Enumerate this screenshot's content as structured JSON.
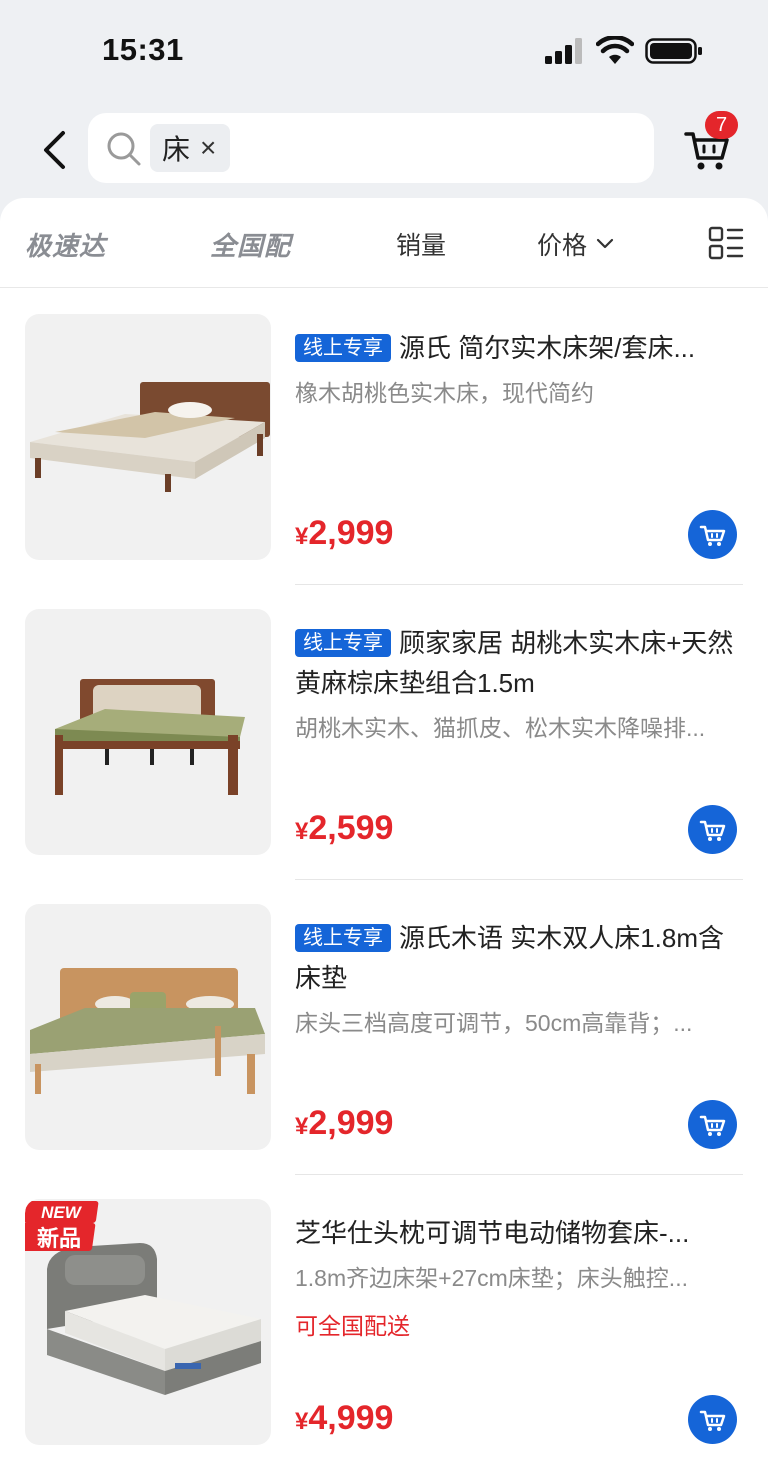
{
  "status_bar": {
    "time": "15:31"
  },
  "search": {
    "chip_label": "床",
    "chip_close": "×"
  },
  "cart": {
    "count": "7"
  },
  "filters": {
    "items": [
      {
        "label": "极速达"
      },
      {
        "label": "全国配"
      },
      {
        "label": "销量"
      },
      {
        "label": "价格"
      }
    ]
  },
  "products": [
    {
      "tag": "线上专享",
      "title": "源氏 简尔实木床架/套床...",
      "subtitle": "橡木胡桃色实木床，现代简约",
      "currency": "¥",
      "price": "2,999"
    },
    {
      "tag": "线上专享",
      "title": "顾家家居 胡桃木实木床+天然黄麻棕床垫组合1.5m",
      "subtitle": "胡桃木实木、猫抓皮、松木实木降噪排...",
      "currency": "¥",
      "price": "2,599"
    },
    {
      "tag": "线上专享",
      "title": "源氏木语 实木双人床1.8m含床垫",
      "subtitle": "床头三档高度可调节，50cm高靠背；...",
      "currency": "¥",
      "price": "2,999"
    },
    {
      "badge_top": "NEW",
      "badge_bottom": "新品",
      "title": "芝华仕头枕可调节电动储物套床-...",
      "subtitle": "1.8m齐边床架+27cm床垫；床头触控...",
      "shipping": "可全国配送",
      "currency": "¥",
      "price": "4,999"
    }
  ],
  "colors": {
    "accent_blue": "#1565d8",
    "price_red": "#e4262b"
  }
}
